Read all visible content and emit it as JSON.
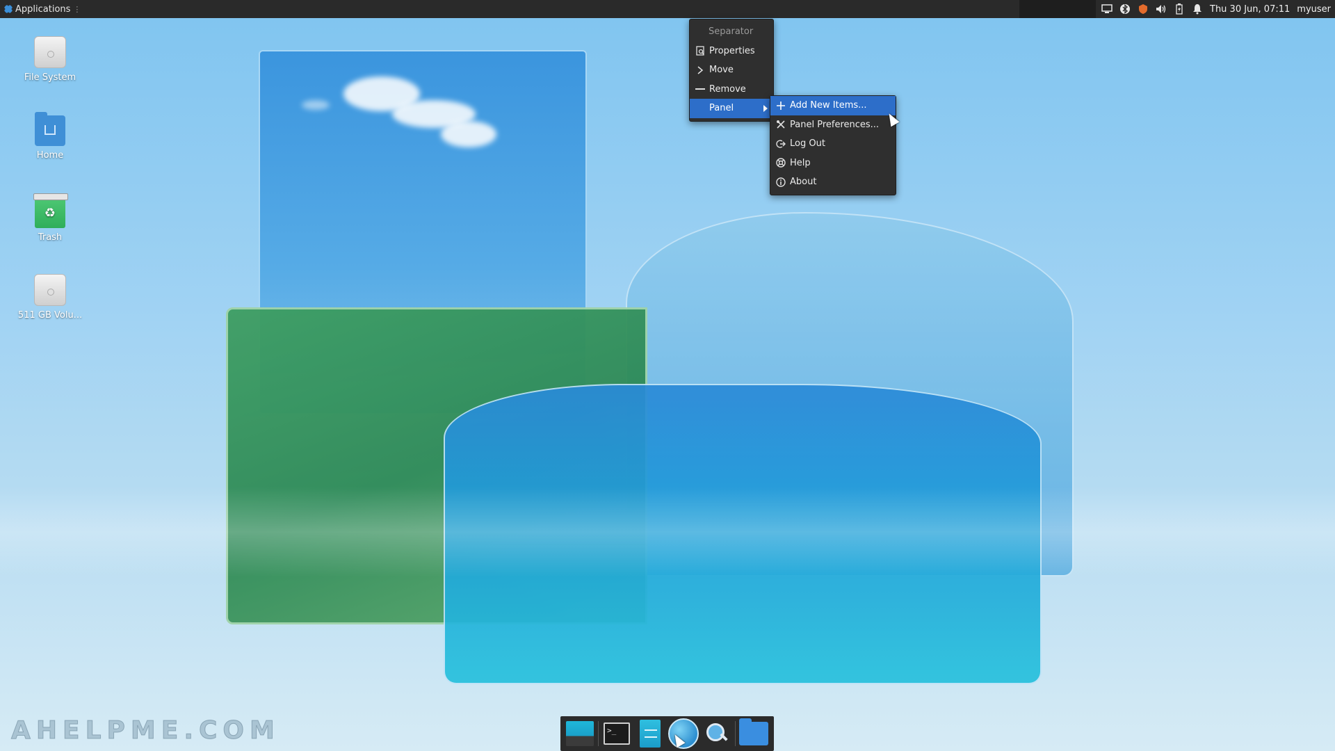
{
  "top_panel": {
    "applications_label": "Applications",
    "clock": "Thu 30 Jun, 07:11",
    "username": "myuser",
    "tray_icons": [
      "display-icon",
      "bluetooth-icon",
      "shield-icon",
      "volume-icon",
      "battery-icon",
      "bell-icon"
    ]
  },
  "desktop_icons": [
    {
      "label": "File System",
      "icon": "drive-icon"
    },
    {
      "label": "Home",
      "icon": "home-folder-icon"
    },
    {
      "label": "Trash",
      "icon": "trash-icon"
    },
    {
      "label": "511 GB Volu...",
      "icon": "drive-icon"
    }
  ],
  "context_menu": {
    "header": "Separator",
    "items": [
      {
        "label": "Properties",
        "icon": "properties-icon"
      },
      {
        "label": "Move",
        "icon": "chevron-right-icon"
      },
      {
        "label": "Remove",
        "icon": "minus-icon"
      },
      {
        "label": "Panel",
        "icon": "",
        "has_submenu": true,
        "active": true
      }
    ]
  },
  "panel_submenu": {
    "items": [
      {
        "label": "Add New Items...",
        "icon": "plus-icon",
        "active": true
      },
      {
        "label": "Panel Preferences...",
        "icon": "tools-icon"
      },
      {
        "label": "Log Out",
        "icon": "logout-icon"
      },
      {
        "label": "Help",
        "icon": "help-icon"
      },
      {
        "label": "About",
        "icon": "info-icon"
      }
    ]
  },
  "dock": {
    "items": [
      "show-desktop-icon",
      "terminal-icon",
      "file-manager-icon",
      "web-browser-icon",
      "app-finder-icon",
      "folder-icon"
    ],
    "terminal_prompt": ">_"
  },
  "watermark": "AHELPME.COM",
  "colors": {
    "panel_bg": "#2a2a2a",
    "menu_bg": "#2f2f2f",
    "accent": "#2d6ec9",
    "desktop_bg": "#8ccaf0"
  }
}
